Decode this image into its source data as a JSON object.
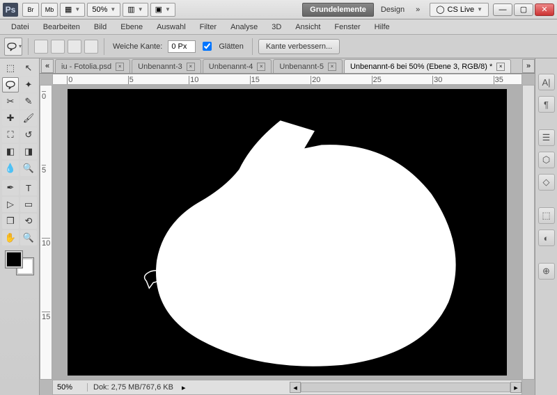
{
  "titlebar": {
    "ps": "Ps",
    "br": "Br",
    "mb": "Mb",
    "zoom": "50%",
    "workspace_active": "Grundelemente",
    "workspace_link": "Design",
    "more": "»",
    "cslive": "CS Live"
  },
  "menu": {
    "items": [
      "Datei",
      "Bearbeiten",
      "Bild",
      "Ebene",
      "Auswahl",
      "Filter",
      "Analyse",
      "3D",
      "Ansicht",
      "Fenster",
      "Hilfe"
    ]
  },
  "options": {
    "feather_label": "Weiche Kante:",
    "feather_value": "0 Px",
    "antialias_label": "Glätten",
    "refine_edge": "Kante verbessern..."
  },
  "tabs": {
    "scroll_l": "«",
    "scroll_r": "»",
    "items": [
      {
        "label": "iu - Fotolia.psd",
        "active": false
      },
      {
        "label": "Unbenannt-3",
        "active": false
      },
      {
        "label": "Unbenannt-4",
        "active": false
      },
      {
        "label": "Unbenannt-5",
        "active": false
      },
      {
        "label": "Unbenannt-6 bei 50% (Ebene 3, RGB/8) *",
        "active": true
      }
    ]
  },
  "ruler_h": [
    "0",
    "5",
    "10",
    "15",
    "20",
    "25",
    "30",
    "35"
  ],
  "ruler_v": [
    "0",
    "5",
    "10",
    "15"
  ],
  "statusbar": {
    "zoom": "50%",
    "docinfo": "Dok: 2,75 MB/767,6 KB"
  },
  "dock_icons": [
    "A|",
    "¶",
    "",
    "☰",
    "⬡",
    "◇",
    "⬚",
    "◐",
    "⊕"
  ]
}
